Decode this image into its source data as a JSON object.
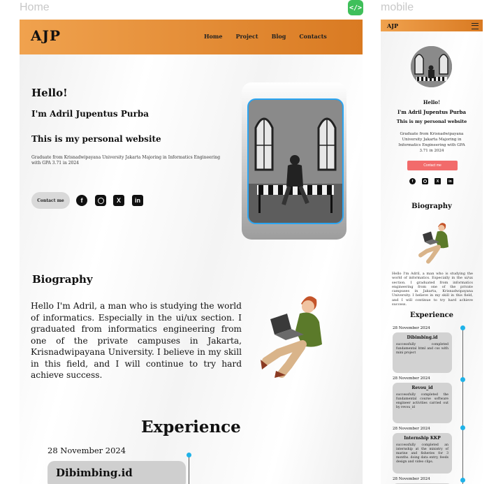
{
  "labels": {
    "home": "Home",
    "mobile": "mobile",
    "code_icon": "code-icon"
  },
  "brand_color": "#e8913a",
  "desktop": {
    "logo": "AJP",
    "nav": [
      "Home",
      "Project",
      "Blog",
      "Contacts"
    ],
    "hero": {
      "hello": "Hello!",
      "name": "I'm Adril Jupentus Purba",
      "tagline": "This is my personal website",
      "description": "Graduate from Krisnadwipayana University Jakarta Majoring in Informatics Engineering with GPA 3.71 in 2024",
      "contact_button": "Contact me"
    },
    "socials": [
      "facebook-icon",
      "instagram-icon",
      "x-icon",
      "linkedin-icon"
    ],
    "biography": {
      "title": "Biography",
      "text": "Hello I'm Adril, a man who is studying the world of informatics. Especially in the ui/ux section. I graduated from informatics engineering from one of the private campuses in Jakarta, Krisnadwipayana University. I believe in my skill in this field, and I will continue to try hard achieve success."
    },
    "experience": {
      "title": "Experience",
      "items": [
        {
          "date": "28 November 2024",
          "title": "Dibimbing.id"
        }
      ]
    }
  },
  "mobile": {
    "logo": "AJP",
    "hello": "Hello!",
    "name": "I'm Adril Jupentus Purba",
    "tagline": "This is my personal website",
    "description": "Graduate from Krisnadwipayana University Jakarta Majoring in Informatics Engineering with GPA 3.71 in 2024",
    "contact_button": "Contact me",
    "biography_title": "Biography",
    "biography_text": "Hello I'm Adril, a man who is studying the world of informatics. Especially in the ui/ux section. I graduated from informatics engineering from one of the private campuses in Jakarta, Krisnadwipayana University. I believe in my skill in this field, and I will continue to try hard achieve success.",
    "experience_title": "Experience",
    "experience": [
      {
        "date": "28 November 2024",
        "title": "Dibimbing.id",
        "desc": "successfully completed fundamental html and css with mini project"
      },
      {
        "date": "28 November 2024",
        "title": "Revou_id",
        "desc": "successfully completed the fundamental course software engineer activities carried out by revou_id"
      },
      {
        "date": "28 November 2024",
        "title": "Internship KKP",
        "desc": "successfully completed an internship at the ministry of marine and fisheries for 3 months. doing data entry, feeds design and video clips."
      },
      {
        "date": "28 November 2024"
      }
    ]
  }
}
